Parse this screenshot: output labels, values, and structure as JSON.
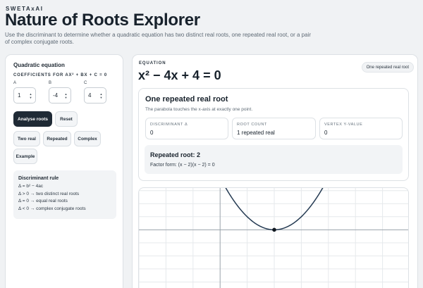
{
  "brand": "SWETAxAI",
  "title": "Nature of Roots Explorer",
  "subtitle": "Use the discriminant to determine whether a quadratic equation has two distinct real roots, one repeated real root, or a pair of complex conjugate roots.",
  "left": {
    "heading": "Quadratic equation",
    "coef_label": "COEFFICIENTS FOR AX² + BX + C = 0",
    "fields": [
      {
        "label": "A",
        "value": "1"
      },
      {
        "label": "B",
        "value": "-4"
      },
      {
        "label": "C",
        "value": "4"
      }
    ],
    "analyse_label": "Analyse roots",
    "reset_label": "Reset",
    "presets": [
      "Two real",
      "Repeated",
      "Complex",
      "Example"
    ],
    "rule": {
      "title": "Discriminant rule",
      "lines": [
        "Δ = b² − 4ac",
        "Δ > 0 → two distinct real roots",
        "Δ = 0 → equal real roots",
        "Δ < 0 → complex conjugate roots"
      ]
    }
  },
  "right": {
    "eq_label": "EQUATION",
    "equation": "x² − 4x + 4 = 0",
    "badge": "One repeated real root",
    "result_title": "One repeated real root",
    "result_desc": "The parabola touches the x-axis at exactly one point.",
    "metrics": [
      {
        "label": "DISCRIMINANT Δ",
        "value": "0"
      },
      {
        "label": "ROOT COUNT",
        "value": "1 repeated real"
      },
      {
        "label": "VERTEX Y-VALUE",
        "value": "0"
      }
    ],
    "root_title": "Repeated root: 2",
    "root_factor": "Factor form: (x − 2)(x − 2) = 0"
  },
  "colors": {
    "accent_dark": "#1f2a35",
    "curve": "#243a52",
    "grid": "#e6e9ec",
    "axis": "#9aa3ab"
  },
  "icons": {
    "spinner": "up-down-arrows"
  },
  "chart_data": {
    "type": "line",
    "function": "y = x^2 - 4x + 4",
    "x": [
      -0.2,
      0,
      0.5,
      1,
      1.5,
      2,
      2.5,
      3,
      3.5,
      4,
      4.2
    ],
    "y": [
      4.84,
      4,
      2.25,
      1,
      0.25,
      0,
      0.25,
      1,
      2.25,
      4,
      4.84
    ],
    "xlim": [
      -3,
      7
    ],
    "ylim": [
      -5,
      3.2
    ],
    "marked_point": {
      "x": 2,
      "y": 0
    },
    "grid": true,
    "title": "",
    "xlabel": "",
    "ylabel": ""
  }
}
